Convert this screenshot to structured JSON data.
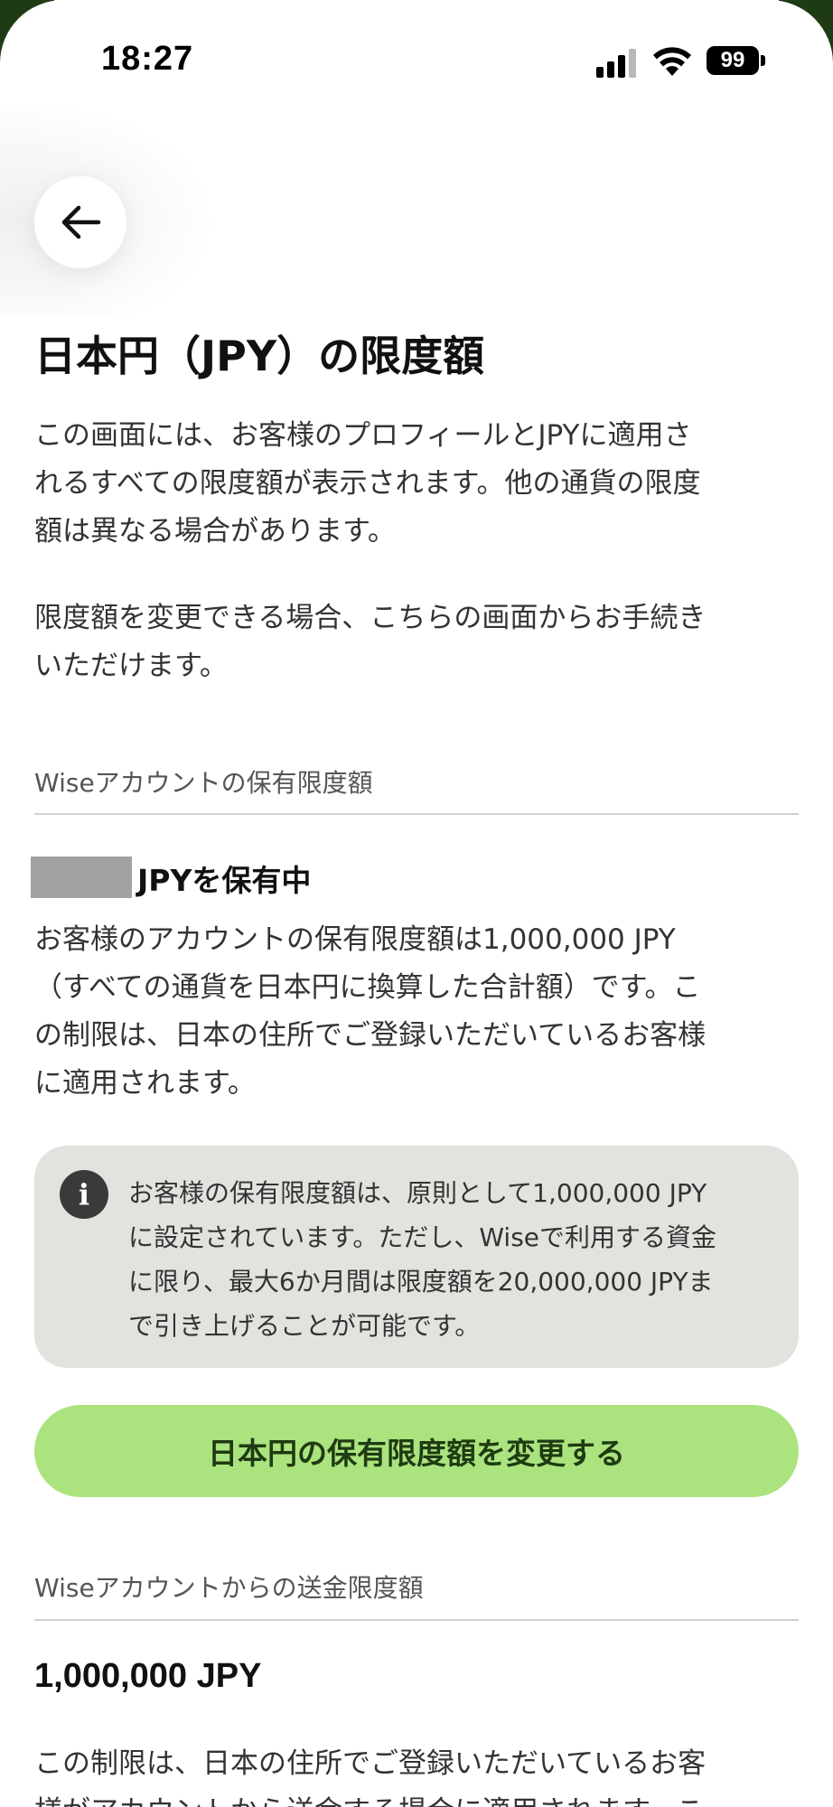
{
  "status_bar": {
    "time": "18:27",
    "battery": "99"
  },
  "header": {
    "back_icon": "arrow-left-icon",
    "title": "日本円（JPY）の限度額"
  },
  "intro": {
    "paragraph1_lines": [
      "この画面には、お客様のプロフィールとJPYに適用さ",
      "れるすべての限度額が表示されます。他の通貨の限度",
      "額は異なる場合があります。"
    ],
    "paragraph2_lines": [
      "限度額を変更できる場合、こちらの画面からお手続き",
      "いただけます。"
    ]
  },
  "holding_section": {
    "label": "Wiseアカウントの保有限度額",
    "title": "JPYを保有中",
    "description_lines": [
      "お客様のアカウントの保有限度額は1,000,000 JPY",
      "（すべての通貨を日本円に換算した合計額）です。こ",
      "の制限は、日本の住所でご登録いただいているお客様",
      "に適用されます。"
    ],
    "info": {
      "icon": "info-icon",
      "lines": [
        "お客様の保有限度額は、原則として1,000,000 JPY",
        "に設定されています。ただし、Wiseで利用する資金",
        "に限り、最大6か月間は限度額を20,000,000 JPYま",
        "で引き上げることが可能です。"
      ]
    },
    "button_label": "日本円の保有限度額を変更する"
  },
  "send_section": {
    "label": "Wiseアカウントからの送金限度額",
    "amount": "1,000,000 JPY",
    "description_lines": [
      "この制限は、日本の住所でご登録いただいているお客",
      "様がアカウントから送金する場合に適用されます。こ"
    ]
  },
  "colors": {
    "accent_button": "#abe37e",
    "button_text": "#1f3b12",
    "info_box_bg": "#e2e3df"
  }
}
